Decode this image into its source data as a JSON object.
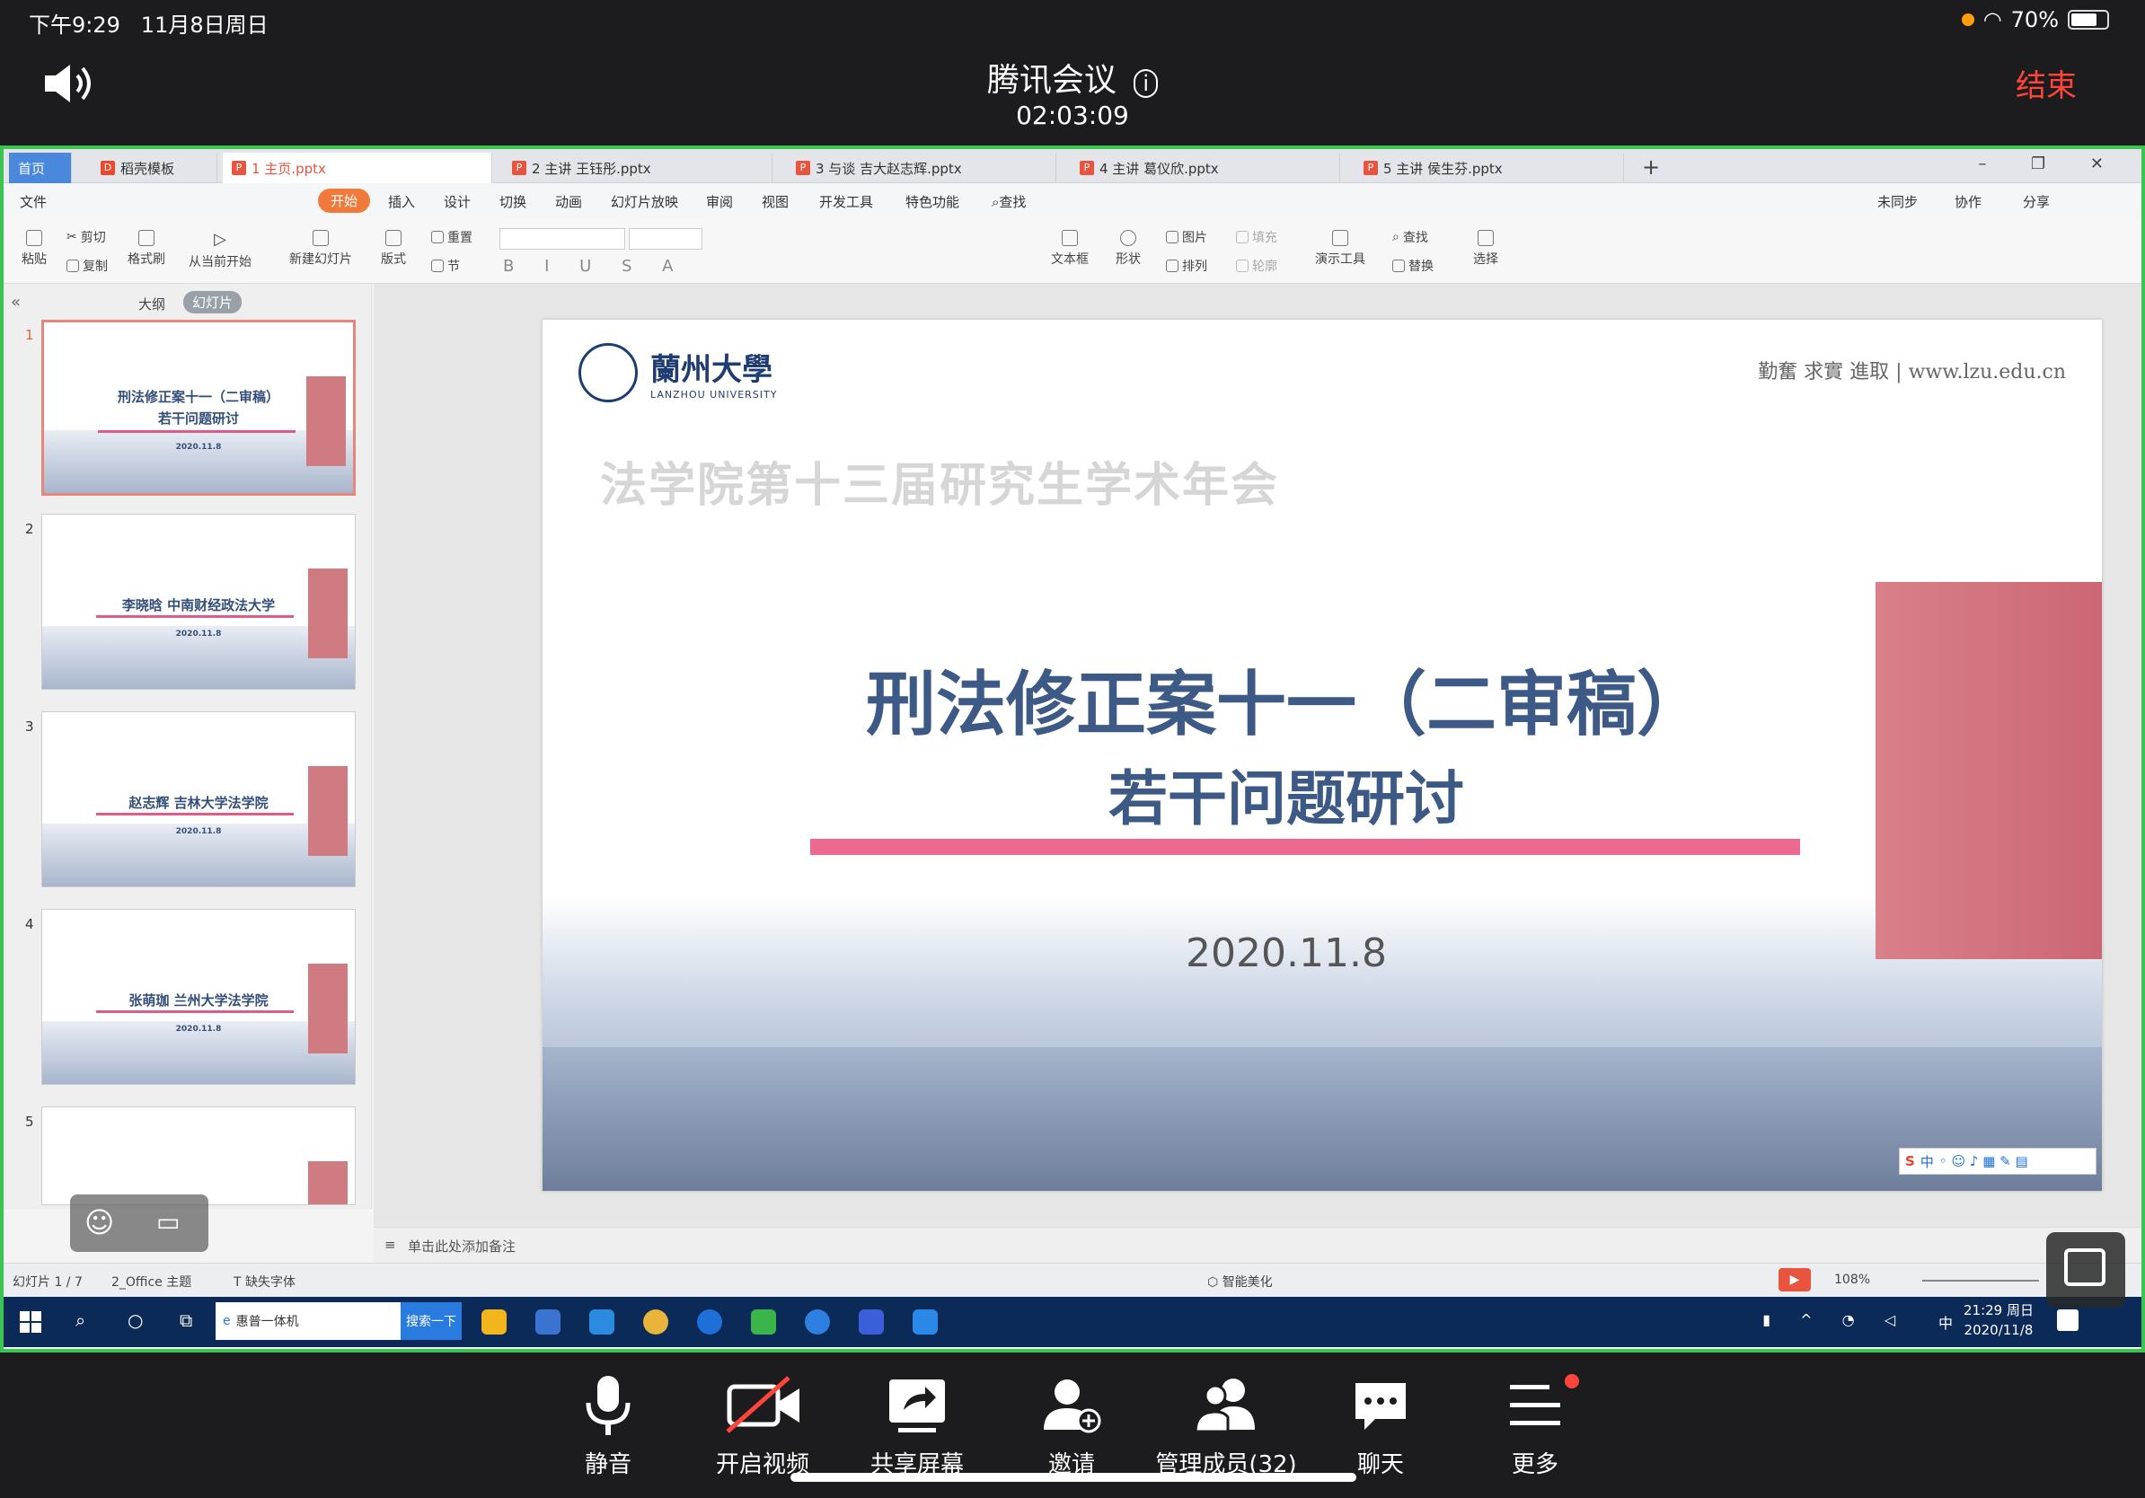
{
  "status": {
    "time": "下午9:29",
    "date": "11月8日周日",
    "battery": "70%"
  },
  "meeting": {
    "title": "腾讯会议",
    "timer": "02:03:09",
    "end": "结束"
  },
  "wps": {
    "tabs": [
      "首页",
      "稻壳模板",
      "1 主页.pptx",
      "2 主讲 王钰彤.pptx",
      "3 与谈 吉大赵志辉.pptx",
      "4 主讲 葛仪欣.pptx",
      "5 主讲 侯生芬.pptx"
    ],
    "menu": [
      "文件",
      "开始",
      "插入",
      "设计",
      "切换",
      "动画",
      "幻灯片放映",
      "审阅",
      "视图",
      "开发工具",
      "特色功能",
      "查找"
    ],
    "menu_right": [
      "未同步",
      "协作",
      "分享"
    ],
    "ribbon": [
      "粘贴",
      "剪切",
      "复制",
      "格式刷",
      "从当前开始",
      "新建幻灯片",
      "版式",
      "重置",
      "节",
      "文本框",
      "形状",
      "图片",
      "排列",
      "填充",
      "轮廓",
      "演示工具",
      "查找",
      "替换",
      "选择"
    ],
    "pane_tabs": [
      "大纲",
      "幻灯片"
    ],
    "thumbs": [
      {
        "num": "1",
        "line1": "刑法修正案十一（二审稿）",
        "line2": "若干问题研讨",
        "date": "2020.11.8"
      },
      {
        "num": "2",
        "line1": "李晓晗 中南财经政法大学",
        "line2": "",
        "date": "2020.11.8"
      },
      {
        "num": "3",
        "line1": "赵志辉 吉林大学法学院",
        "line2": "",
        "date": "2020.11.8"
      },
      {
        "num": "4",
        "line1": "张萌珈 兰州大学法学院",
        "line2": "",
        "date": "2020.11.8"
      },
      {
        "num": "5",
        "line1": "",
        "line2": "",
        "date": ""
      }
    ],
    "slide": {
      "logo_cn": "蘭州大學",
      "logo_en": "LANZHOU UNIVERSITY",
      "motto": "勤奮 求實 進取 | www.lzu.edu.cn",
      "ghost": "法学院第十三届研究生学术年会",
      "title1": "刑法修正案十一（二审稿）",
      "title2": "若干问题研讨",
      "date": "2020.11.8"
    },
    "notes": "单击此处添加备注",
    "status": {
      "slide": "幻灯片 1 / 7",
      "theme": "2_Office 主题",
      "font": "缺失字体",
      "beautify": "智能美化",
      "zoom": "108%"
    }
  },
  "taskbar": {
    "search": "惠普一体机",
    "search_btn": "搜索一下",
    "clock_time": "21:29 周日",
    "clock_date": "2020/11/8",
    "ime": "中"
  },
  "bottom": [
    "静音",
    "开启视频",
    "共享屏幕",
    "邀请",
    "管理成员(32)",
    "聊天",
    "更多"
  ]
}
